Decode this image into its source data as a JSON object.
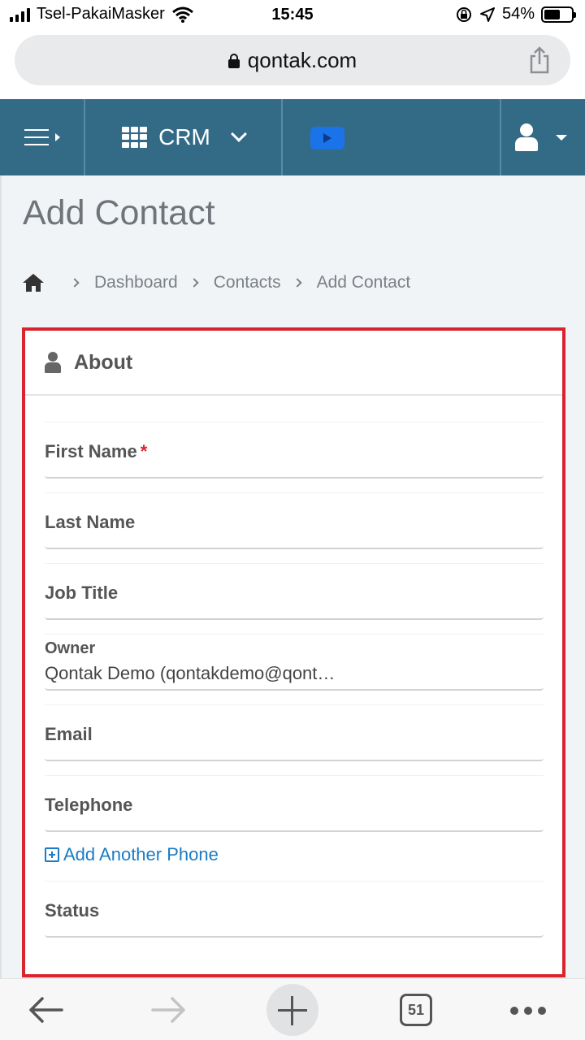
{
  "status_bar": {
    "carrier": "Tsel-PakaiMasker",
    "time": "15:45",
    "battery": "54%",
    "battery_level": 0.54
  },
  "browser": {
    "url": "qontak.com",
    "tab_count": "51"
  },
  "header": {
    "app_switcher_label": "CRM"
  },
  "page": {
    "title": "Add Contact",
    "breadcrumb": [
      "Dashboard",
      "Contacts",
      "Add Contact"
    ]
  },
  "card": {
    "title": "About",
    "fields": {
      "first_name": {
        "label": "First Name",
        "required_mark": "*"
      },
      "last_name": {
        "label": "Last Name"
      },
      "job_title": {
        "label": "Job Title"
      },
      "owner": {
        "label": "Owner",
        "value": "Qontak Demo (qontakdemo@qont…"
      },
      "email": {
        "label": "Email"
      },
      "telephone": {
        "label": "Telephone"
      },
      "status": {
        "label": "Status"
      }
    },
    "add_phone_label": "Add Another Phone"
  },
  "colors": {
    "header_bg": "#336b87",
    "highlight_border": "#d9232d",
    "link": "#1b7bc4",
    "video_button": "#1a73e8"
  }
}
